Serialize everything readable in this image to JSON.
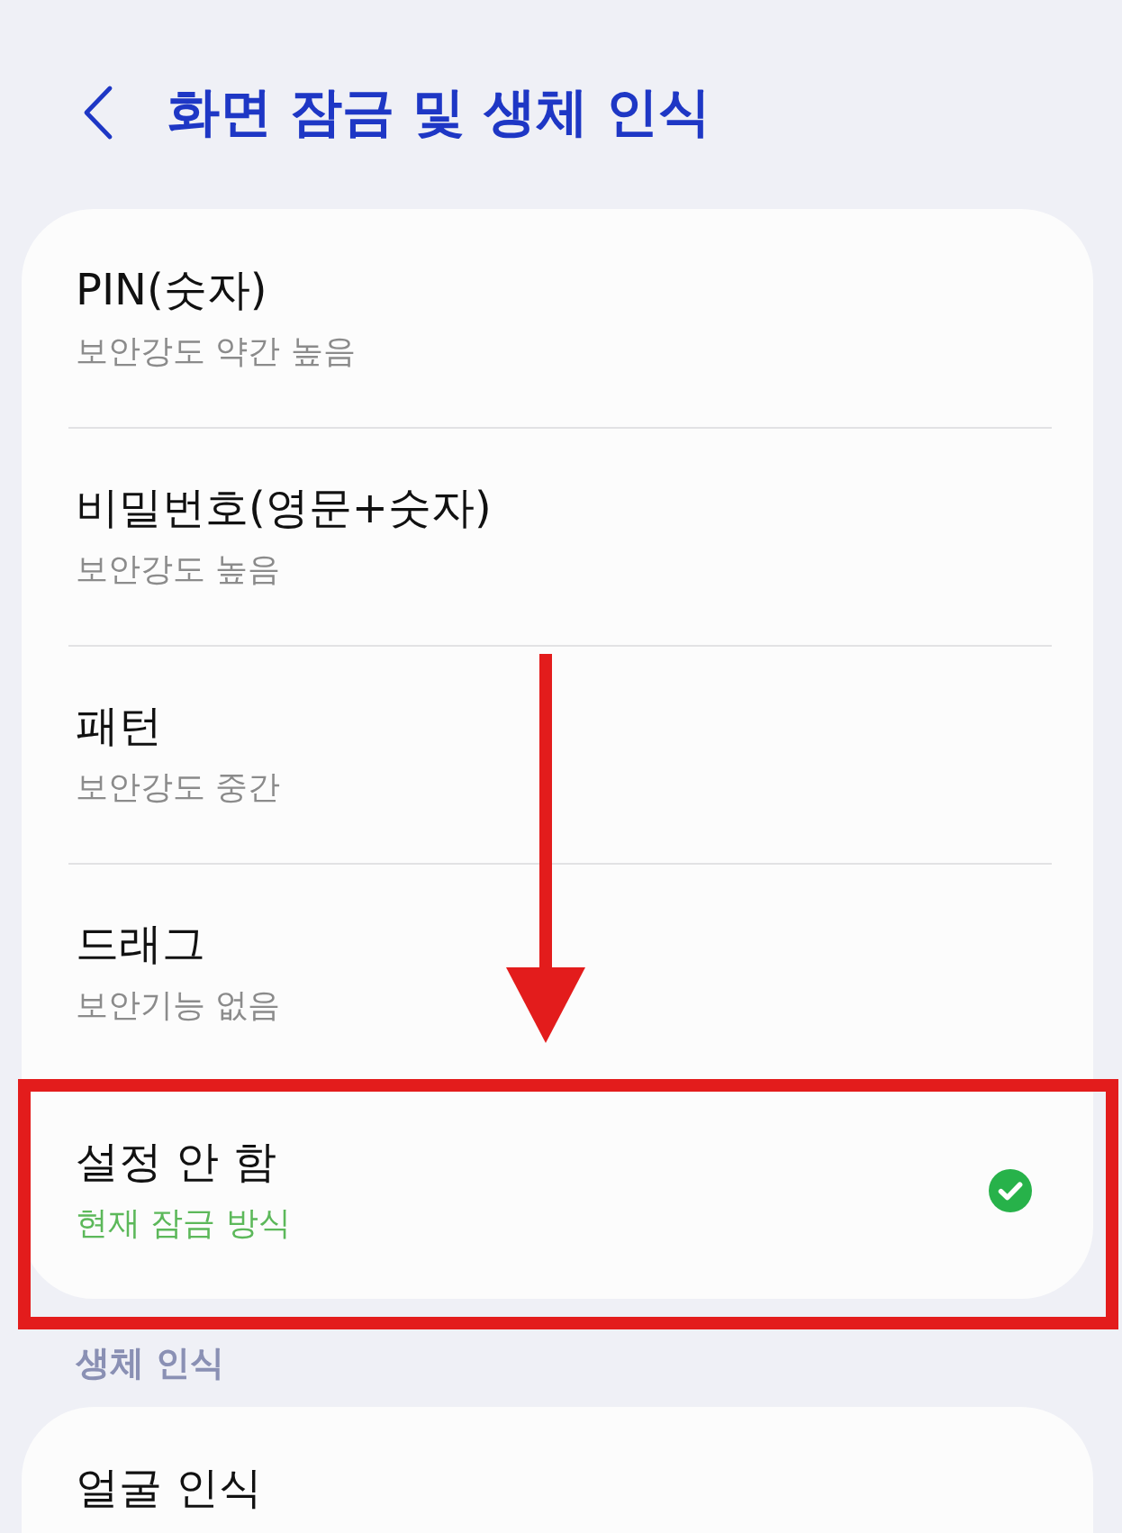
{
  "header": {
    "title": "화면 잠금 및 생체 인식"
  },
  "lock_types": {
    "items": [
      {
        "title": "PIN(숫자)",
        "subtitle": "보안강도 약간 높음",
        "selected": false,
        "highlighted": false
      },
      {
        "title": "비밀번호(영문+숫자)",
        "subtitle": "보안강도 높음",
        "selected": false,
        "highlighted": false
      },
      {
        "title": "패턴",
        "subtitle": "보안강도 중간",
        "selected": false,
        "highlighted": false
      },
      {
        "title": "드래그",
        "subtitle": "보안기능 없음",
        "selected": false,
        "highlighted": false
      },
      {
        "title": "설정 안 함",
        "subtitle": "현재 잠금 방식",
        "selected": true,
        "highlighted": true
      }
    ]
  },
  "biometrics": {
    "section_title": "생체 인식",
    "items": [
      {
        "title": "얼굴 인식"
      }
    ]
  }
}
